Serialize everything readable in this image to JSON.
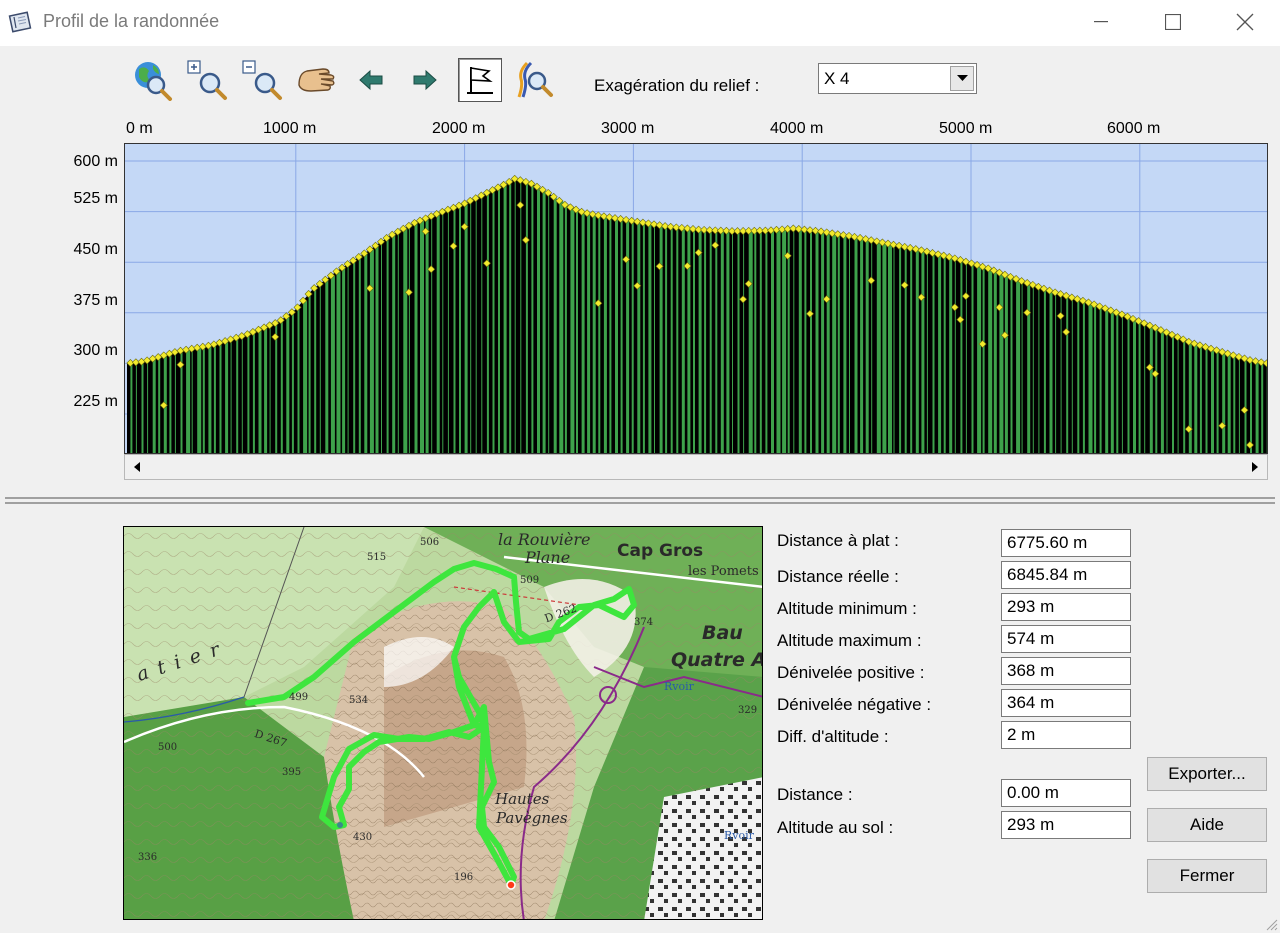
{
  "window": {
    "title": "Profil de la randonnée"
  },
  "toolbar": {
    "icons": [
      "globe-search-icon",
      "zoom-in-icon",
      "zoom-out-icon",
      "pan-hand-icon",
      "arrow-left-icon",
      "arrow-right-icon",
      "flag-profile-icon",
      "route-search-icon"
    ],
    "relief_label": "Exagération du relief :",
    "relief_value": "X 4"
  },
  "profile": {
    "x_ticks": [
      "0 m",
      "1000 m",
      "2000 m",
      "3000 m",
      "4000 m",
      "5000 m",
      "6000 m"
    ],
    "y_ticks": [
      "600 m",
      "525 m",
      "450 m",
      "375 m",
      "300 m",
      "225 m"
    ],
    "colors": {
      "sky": "#c4d8f6",
      "terrain": "#000000",
      "strip": "#3ea24b",
      "point": "#f3eb2d",
      "grid": "#8aa8e6"
    }
  },
  "chart_data": {
    "type": "area",
    "xlabel": "",
    "ylabel": "",
    "xlim": [
      0,
      6775.6
    ],
    "ylim": [
      165,
      625
    ],
    "x": [
      0,
      100,
      300,
      500,
      700,
      800,
      900,
      1000,
      1100,
      1250,
      1400,
      1550,
      1700,
      1850,
      2000,
      2150,
      2250,
      2300,
      2400,
      2500,
      2600,
      2700,
      2800,
      2900,
      3000,
      3200,
      3400,
      3600,
      3800,
      3950,
      4100,
      4300,
      4500,
      4700,
      4900,
      5100,
      5300,
      5500,
      5700,
      5900,
      6100,
      6300,
      6500,
      6650,
      6775.6
    ],
    "y": [
      300,
      303,
      318,
      327,
      342,
      352,
      362,
      380,
      410,
      438,
      462,
      488,
      508,
      523,
      537,
      555,
      567,
      574,
      566,
      552,
      534,
      524,
      519,
      515,
      511,
      503,
      498,
      496,
      497,
      500,
      496,
      488,
      478,
      468,
      456,
      441,
      422,
      405,
      390,
      372,
      352,
      331,
      316,
      305,
      299
    ]
  },
  "map": {
    "labels": [
      "la Rouvière",
      "Plane",
      "Cap Gros",
      "les Pomets",
      "Bau",
      "Quatre A",
      "Hautes",
      "Pavègnes",
      "a t i e r",
      "Rvoir",
      "Rvoir",
      "D 262",
      "D 267",
      "515",
      "509",
      "374",
      "534",
      "499",
      "395",
      "430",
      "500",
      "336",
      "196",
      "329",
      "506"
    ]
  },
  "stats": {
    "distance_plat_label": "Distance à plat :",
    "distance_plat": "6775.60 m",
    "distance_reelle_label": "Distance réelle :",
    "distance_reelle": "6845.84 m",
    "alt_min_label": "Altitude minimum :",
    "alt_min": "293 m",
    "alt_max_label": "Altitude maximum :",
    "alt_max": "574 m",
    "den_pos_label": "Dénivelée positive :",
    "den_pos": "368 m",
    "den_neg_label": "Dénivelée négative :",
    "den_neg": "364 m",
    "diff_label": "Diff. d'altitude :",
    "diff": "2 m",
    "distance_label": "Distance :",
    "distance": "0.00 m",
    "alt_sol_label": "Altitude au sol :",
    "alt_sol": "293 m"
  },
  "buttons": {
    "exporter": "Exporter...",
    "aide": "Aide",
    "fermer": "Fermer"
  }
}
